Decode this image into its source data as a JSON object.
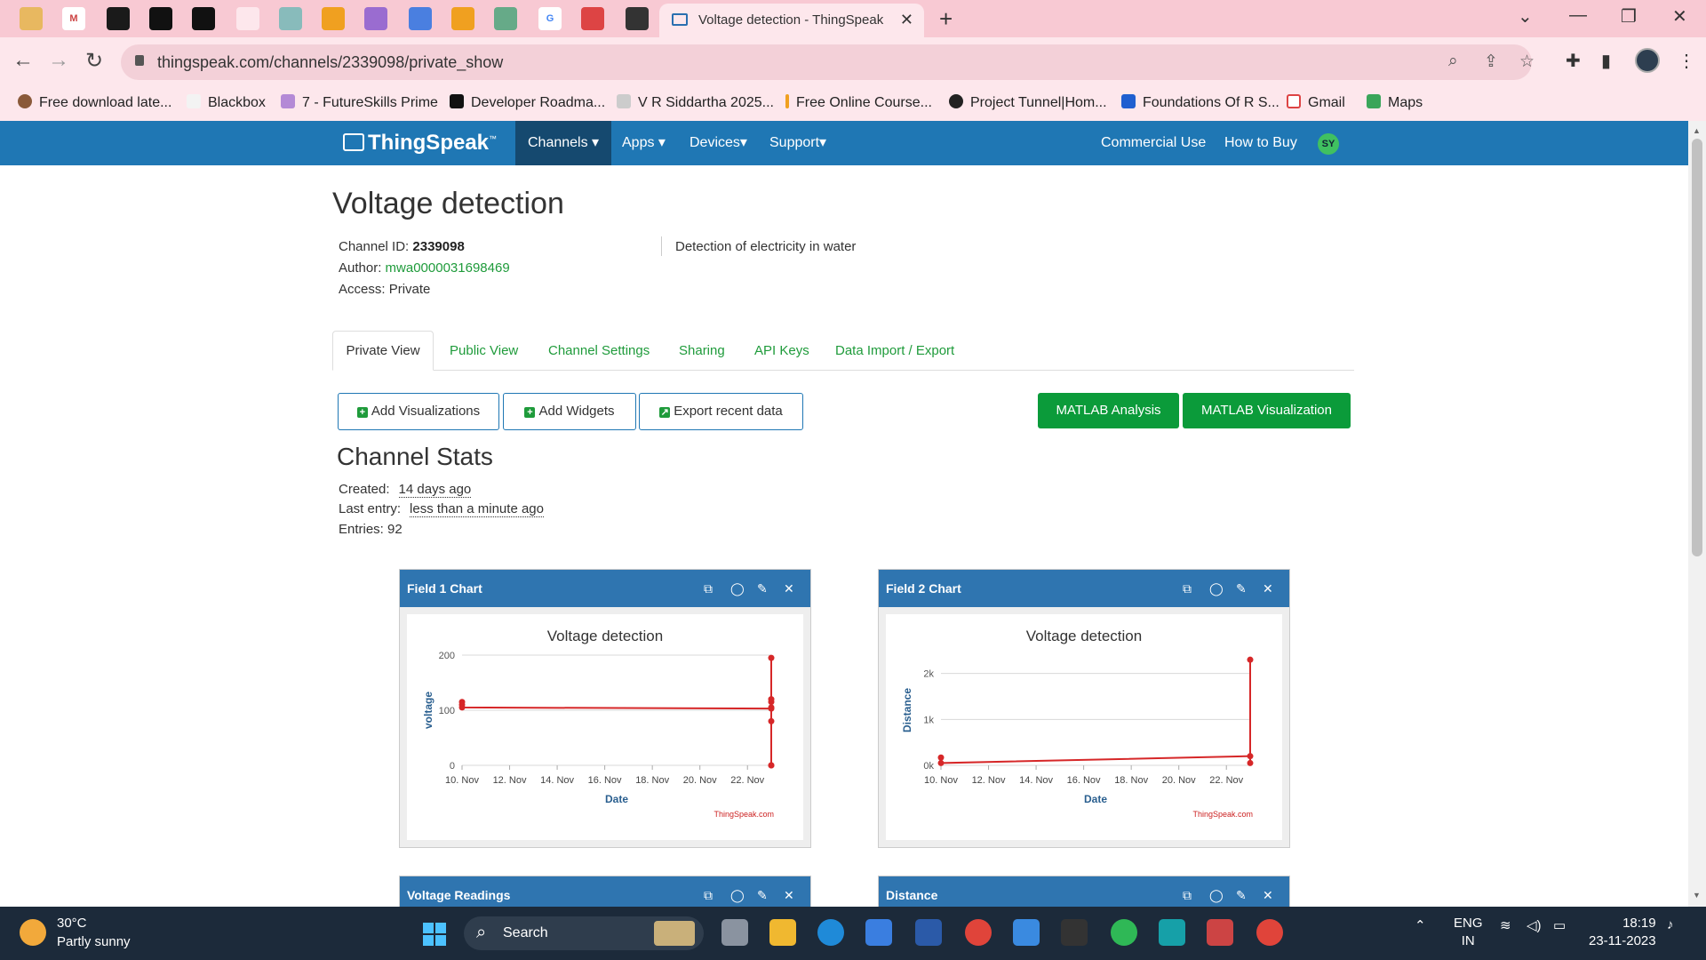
{
  "browser": {
    "active_tab_title": "Voltage detection - ThingSpeak",
    "url": "thingspeak.com/channels/2339098/private_show",
    "bookmarks": [
      "Free download late...",
      "Blackbox",
      "7 - FutureSkills Prime",
      "Developer Roadma...",
      "V R Siddartha 2025...",
      "Free Online Course...",
      "Project Tunnel|Hom...",
      "Foundations Of R S...",
      "Gmail",
      "Maps"
    ]
  },
  "navbar": {
    "logo": "ThingSpeak",
    "logo_tm": "™",
    "menus": [
      "Channels ▾",
      "Apps ▾",
      "Devices▾",
      "Support▾"
    ],
    "commercial_use": "Commercial Use",
    "how_to_buy": "How to Buy",
    "user_initials": "SY"
  },
  "channel": {
    "title": "Voltage detection",
    "id_label": "Channel ID:",
    "id_value": "2339098",
    "author_label": "Author:",
    "author_value": "mwa0000031698469",
    "access_label": "Access:",
    "access_value": "Private",
    "description": "Detection of electricity in water"
  },
  "tabs": [
    "Private View",
    "Public View",
    "Channel Settings",
    "Sharing",
    "API Keys",
    "Data Import / Export"
  ],
  "actions": {
    "add_visualizations": "Add Visualizations",
    "add_widgets": "Add Widgets",
    "export_recent": "Export recent data",
    "matlab_analysis": "MATLAB Analysis",
    "matlab_visualization": "MATLAB Visualization"
  },
  "stats": {
    "title": "Channel Stats",
    "created_label": "Created:",
    "created_value": "14 days ago",
    "last_entry_label": "Last entry:",
    "last_entry_value": "less than a minute ago",
    "entries_label": "Entries:",
    "entries_value": "92"
  },
  "widgets": {
    "field1": "Field 1 Chart",
    "field2": "Field 2 Chart",
    "voltage_readings": "Voltage Readings",
    "distance": "Distance"
  },
  "colors": {
    "navbar": "#1f77b4",
    "widget_header": "#2f75b0",
    "series": "#d62728",
    "link_green": "#1f9b3b",
    "matlab_button": "#0b9b3a"
  },
  "chart_data": [
    {
      "type": "line",
      "title": "Voltage detection",
      "xlabel": "Date",
      "ylabel": "voltage",
      "credit": "ThingSpeak.com",
      "x_ticks": [
        "10. Nov",
        "12. Nov",
        "14. Nov",
        "16. Nov",
        "18. Nov",
        "20. Nov",
        "22. Nov"
      ],
      "y_ticks": [
        "0",
        "100",
        "200"
      ],
      "ylim": [
        0,
        200
      ],
      "xlim": [
        "2023-11-10",
        "2023-11-23"
      ],
      "grid": true,
      "series": [
        {
          "x": [
            "2023-11-10",
            "2023-11-10",
            "2023-11-10",
            "2023-11-23",
            "2023-11-23",
            "2023-11-23",
            "2023-11-23",
            "2023-11-23",
            "2023-11-23",
            "2023-11-23",
            "2023-11-23"
          ],
          "values": [
            115,
            110,
            105,
            103,
            120,
            115,
            105,
            80,
            0,
            195,
            0
          ]
        }
      ]
    },
    {
      "type": "line",
      "title": "Voltage detection",
      "xlabel": "Date",
      "ylabel": "Distance",
      "credit": "ThingSpeak.com",
      "x_ticks": [
        "10. Nov",
        "12. Nov",
        "14. Nov",
        "16. Nov",
        "18. Nov",
        "20. Nov",
        "22. Nov"
      ],
      "y_ticks": [
        "0k",
        "1k",
        "2k"
      ],
      "ylim": [
        0,
        2400
      ],
      "xlim": [
        "2023-11-10",
        "2023-11-23"
      ],
      "grid": true,
      "series": [
        {
          "x": [
            "2023-11-10",
            "2023-11-10",
            "2023-11-23",
            "2023-11-23",
            "2023-11-23"
          ],
          "values": [
            170,
            50,
            200,
            2300,
            50
          ]
        }
      ]
    }
  ],
  "taskbar": {
    "temperature": "30°C",
    "weather": "Partly sunny",
    "search": "Search",
    "lang_top": "ENG",
    "lang_bottom": "IN",
    "time": "18:19",
    "date": "23-11-2023"
  }
}
